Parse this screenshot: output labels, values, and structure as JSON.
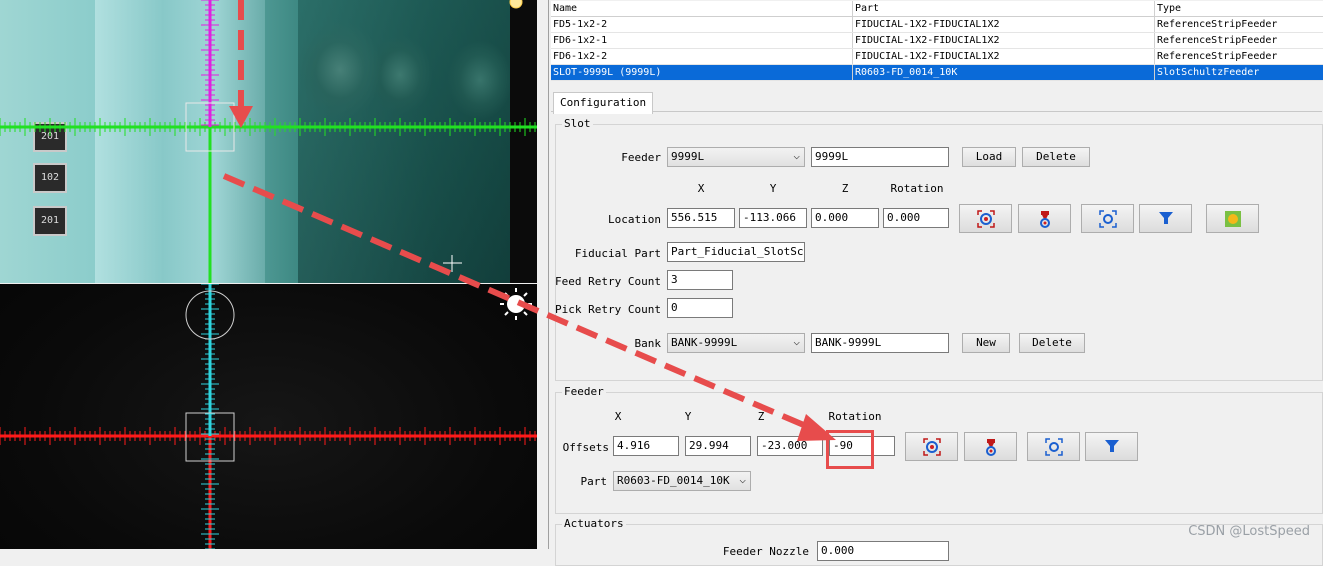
{
  "feeder_table": {
    "columns": [
      "Name",
      "Part",
      "Type"
    ],
    "rows": [
      {
        "name": "FD5-1x2-2",
        "part": "FIDUCIAL-1X2-FIDUCIAL1X2",
        "type": "ReferenceStripFeeder"
      },
      {
        "name": "FD6-1x2-1",
        "part": "FIDUCIAL-1X2-FIDUCIAL1X2",
        "type": "ReferenceStripFeeder"
      },
      {
        "name": "FD6-1x2-2",
        "part": "FIDUCIAL-1X2-FIDUCIAL1X2",
        "type": "ReferenceStripFeeder"
      },
      {
        "name": "SLOT-9999L (9999L)",
        "part": "R0603-FD_0014_10K",
        "type": "SlotSchultzFeeder",
        "selected": true
      }
    ]
  },
  "tabs": [
    "Configuration"
  ],
  "slot": {
    "title": "Slot",
    "feeder_label": "Feeder",
    "feeder_select": "9999L",
    "feeder_name": "9999L",
    "load_label": "Load",
    "delete_label": "Delete",
    "col_x": "X",
    "col_y": "Y",
    "col_z": "Z",
    "col_rotation": "Rotation",
    "location_label": "Location",
    "location": {
      "x": "556.515",
      "y": "-113.066",
      "z": "0.000",
      "rotation": "0.000"
    },
    "fiducial_part_label": "Fiducial Part",
    "fiducial_part": "Part_Fiducial_SlotSchu",
    "feed_retry_label": "Feed Retry Count",
    "feed_retry": "3",
    "pick_retry_label": "Pick Retry Count",
    "pick_retry": "0",
    "bank_label": "Bank",
    "bank_select": "BANK-9999L",
    "bank_name": "BANK-9999L",
    "new_label": "New",
    "bank_delete_label": "Delete"
  },
  "feeder": {
    "title": "Feeder",
    "col_x": "X",
    "col_y": "Y",
    "col_z": "Z",
    "col_rotation": "Rotation",
    "offsets_label": "Offsets",
    "offsets": {
      "x": "4.916",
      "y": "29.994",
      "z": "-23.000",
      "rotation": "-90"
    },
    "part_label": "Part",
    "part_select": "R0603-FD_0014_10K"
  },
  "actuators": {
    "title": "Actuators",
    "row_label": "Feeder Nozzle",
    "row_value": "0.000"
  },
  "camera": {
    "components": [
      "201",
      "102",
      "201"
    ]
  },
  "watermark": "CSDN @LostSpeed",
  "colors": {
    "selection": "#0a6ad8",
    "annotation": "#e74c4c",
    "crosshair_top": "#22e022",
    "crosshair_bottom": "#ff1a1a",
    "crosshair_vertical_top": "#e020e0",
    "crosshair_vertical_bottom": "#2fd6e0"
  }
}
